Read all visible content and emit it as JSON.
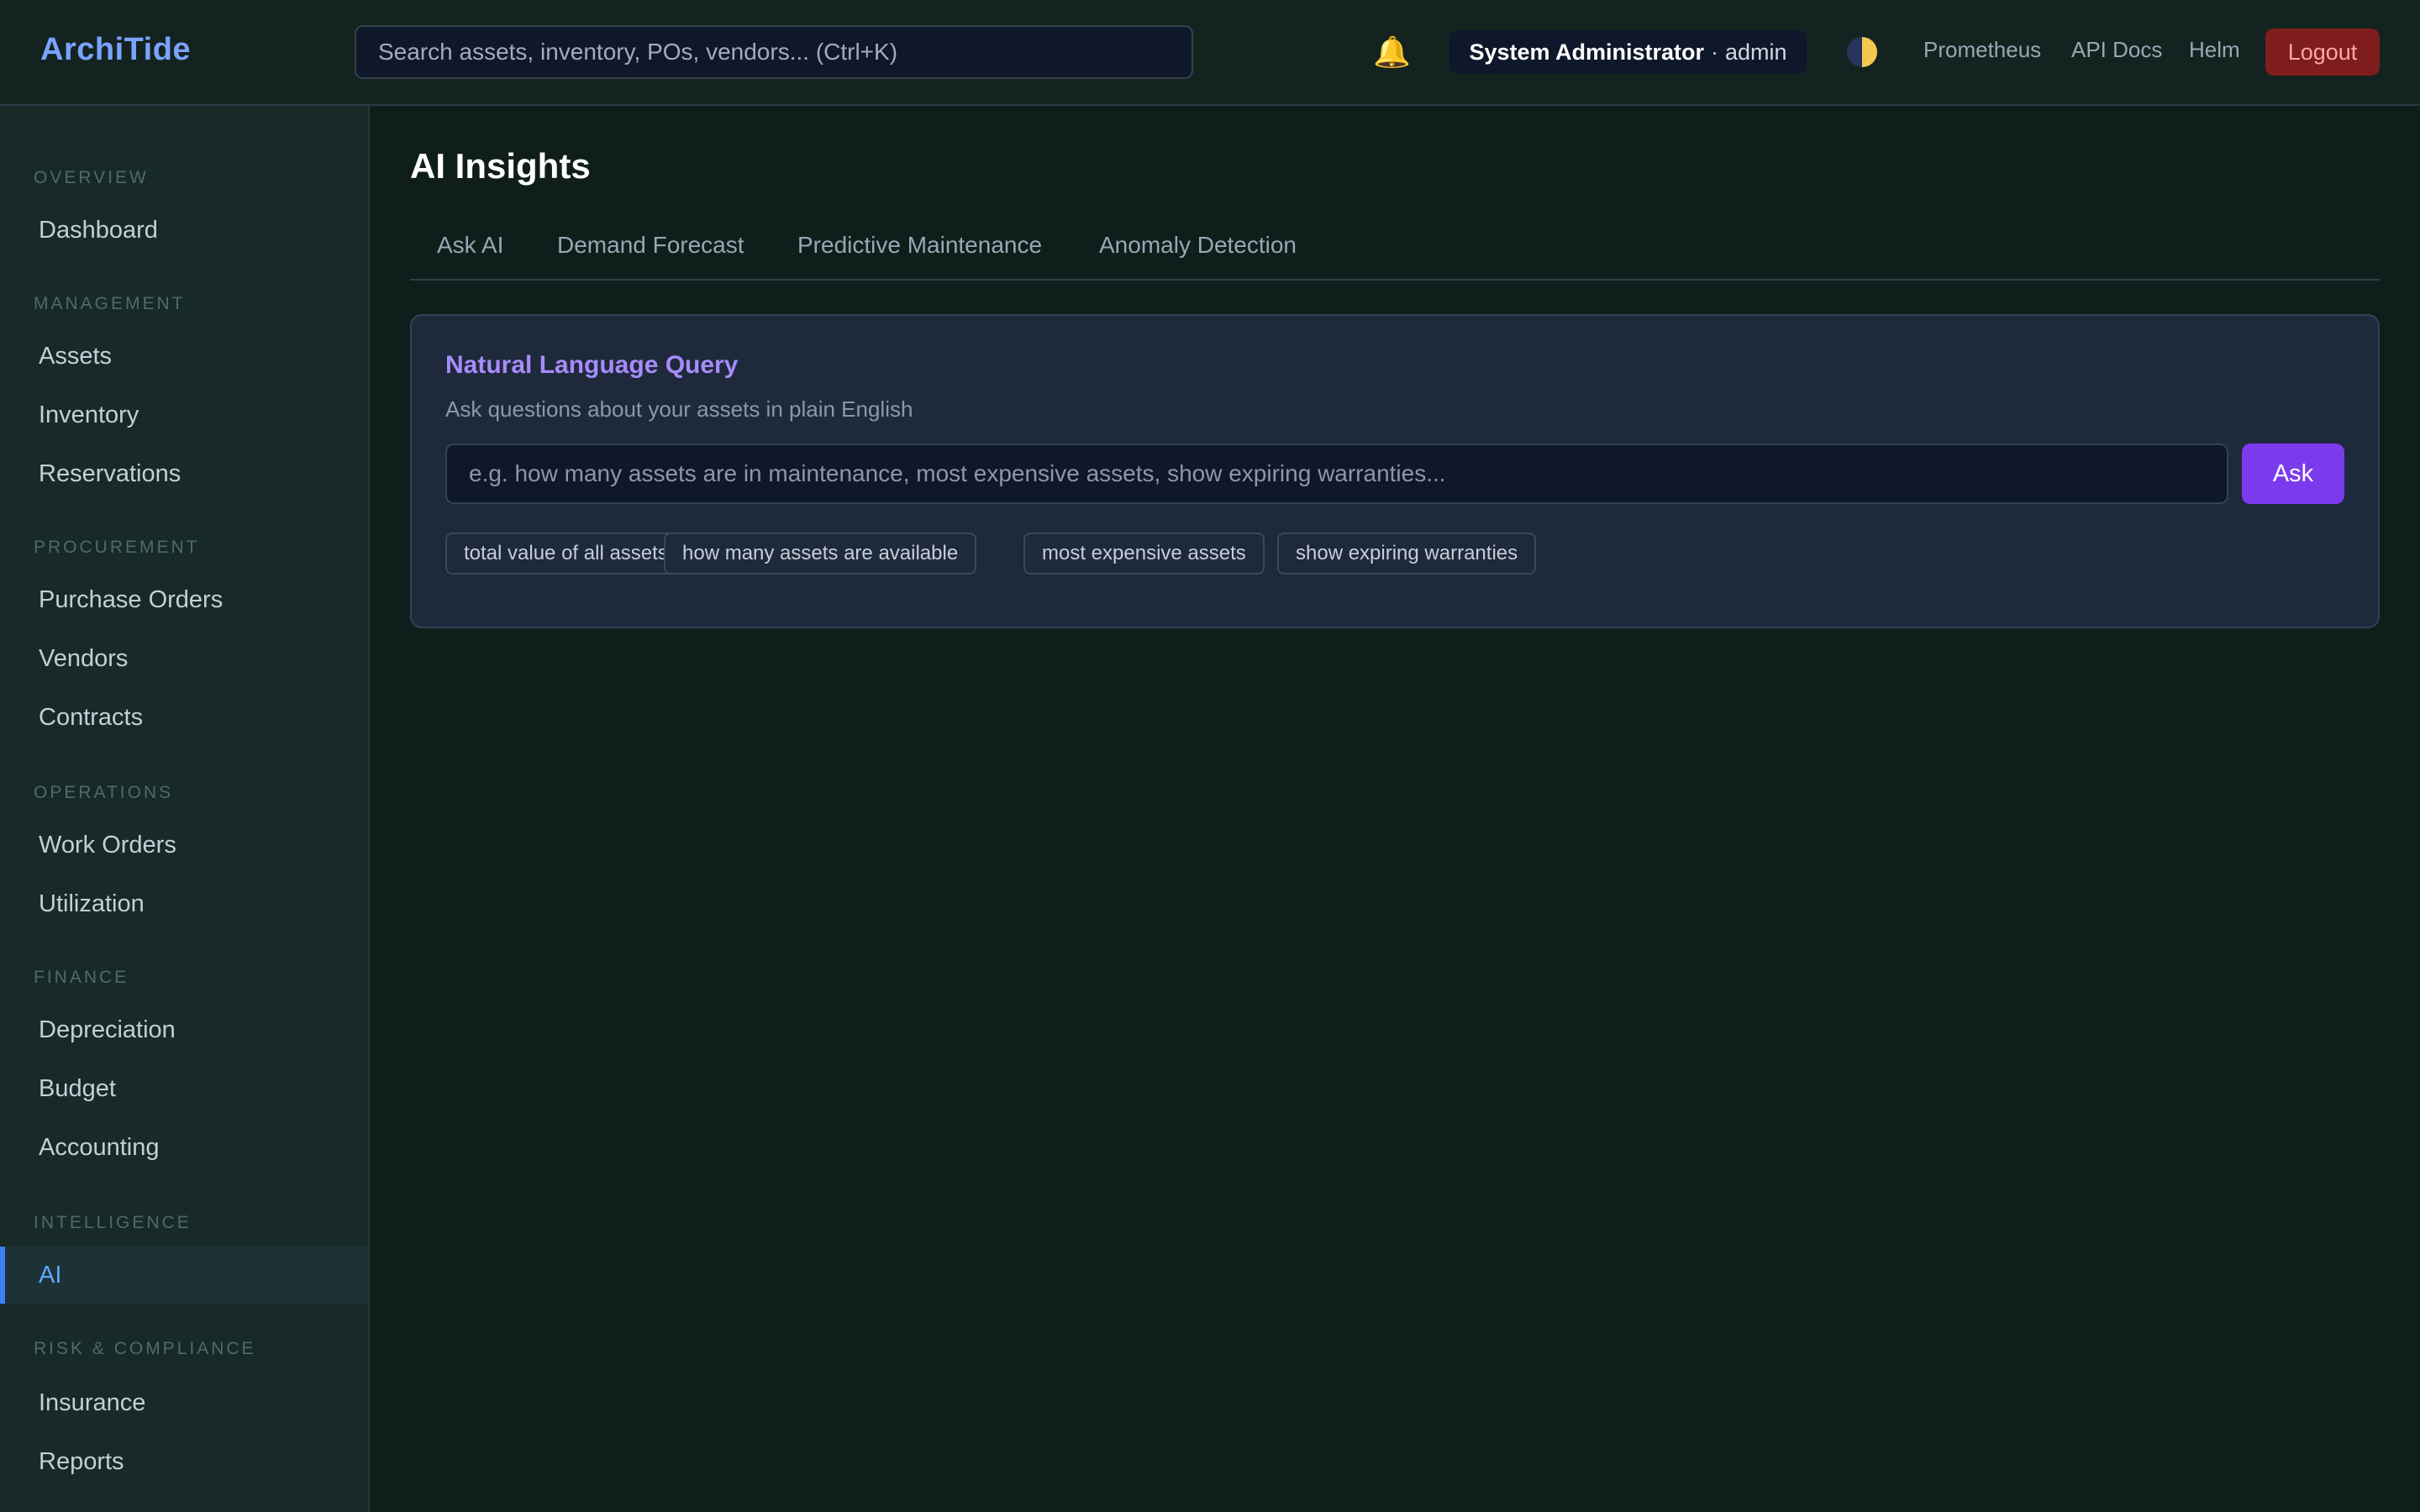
{
  "header": {
    "brand": "ArchiTide",
    "search_placeholder": "Search assets, inventory, POs, vendors... (Ctrl+K)",
    "notification_icon": "bell-icon",
    "user": {
      "name": "System Administrator",
      "separator": "·",
      "username": "admin"
    },
    "theme_icon": "half-moon-icon",
    "links": [
      "Prometheus",
      "API Docs",
      "Helm"
    ],
    "logout_label": "Logout"
  },
  "sidebar": {
    "sections": [
      {
        "label": "OVERVIEW",
        "items": [
          "Dashboard"
        ]
      },
      {
        "label": "MANAGEMENT",
        "items": [
          "Assets",
          "Inventory",
          "Reservations"
        ]
      },
      {
        "label": "PROCUREMENT",
        "items": [
          "Purchase Orders",
          "Vendors",
          "Contracts"
        ]
      },
      {
        "label": "OPERATIONS",
        "items": [
          "Work Orders",
          "Utilization"
        ]
      },
      {
        "label": "FINANCE",
        "items": [
          "Depreciation",
          "Budget",
          "Accounting"
        ]
      },
      {
        "label": "INTELLIGENCE",
        "items": [
          "AI"
        ]
      },
      {
        "label": "RISK & COMPLIANCE",
        "items": [
          "Insurance",
          "Reports"
        ]
      }
    ],
    "active_item": "AI"
  },
  "main": {
    "title": "AI Insights",
    "tabs": [
      "Ask AI",
      "Demand Forecast",
      "Predictive Maintenance",
      "Anomaly Detection"
    ],
    "query_card": {
      "title": "Natural Language Query",
      "subtitle": "Ask questions about your assets in plain English",
      "input_placeholder": "e.g. how many assets are in maintenance, most expensive assets, show expiring warranties...",
      "ask_label": "Ask",
      "suggestions": [
        "total value of all assets",
        "how many assets are available",
        "most expensive assets",
        "show expiring warranties"
      ]
    }
  },
  "colors": {
    "accent": "#7c3aed",
    "brand": "#7aa2ff",
    "active_nav": "#3b82f6",
    "logout_bg": "#7f1d1d"
  }
}
